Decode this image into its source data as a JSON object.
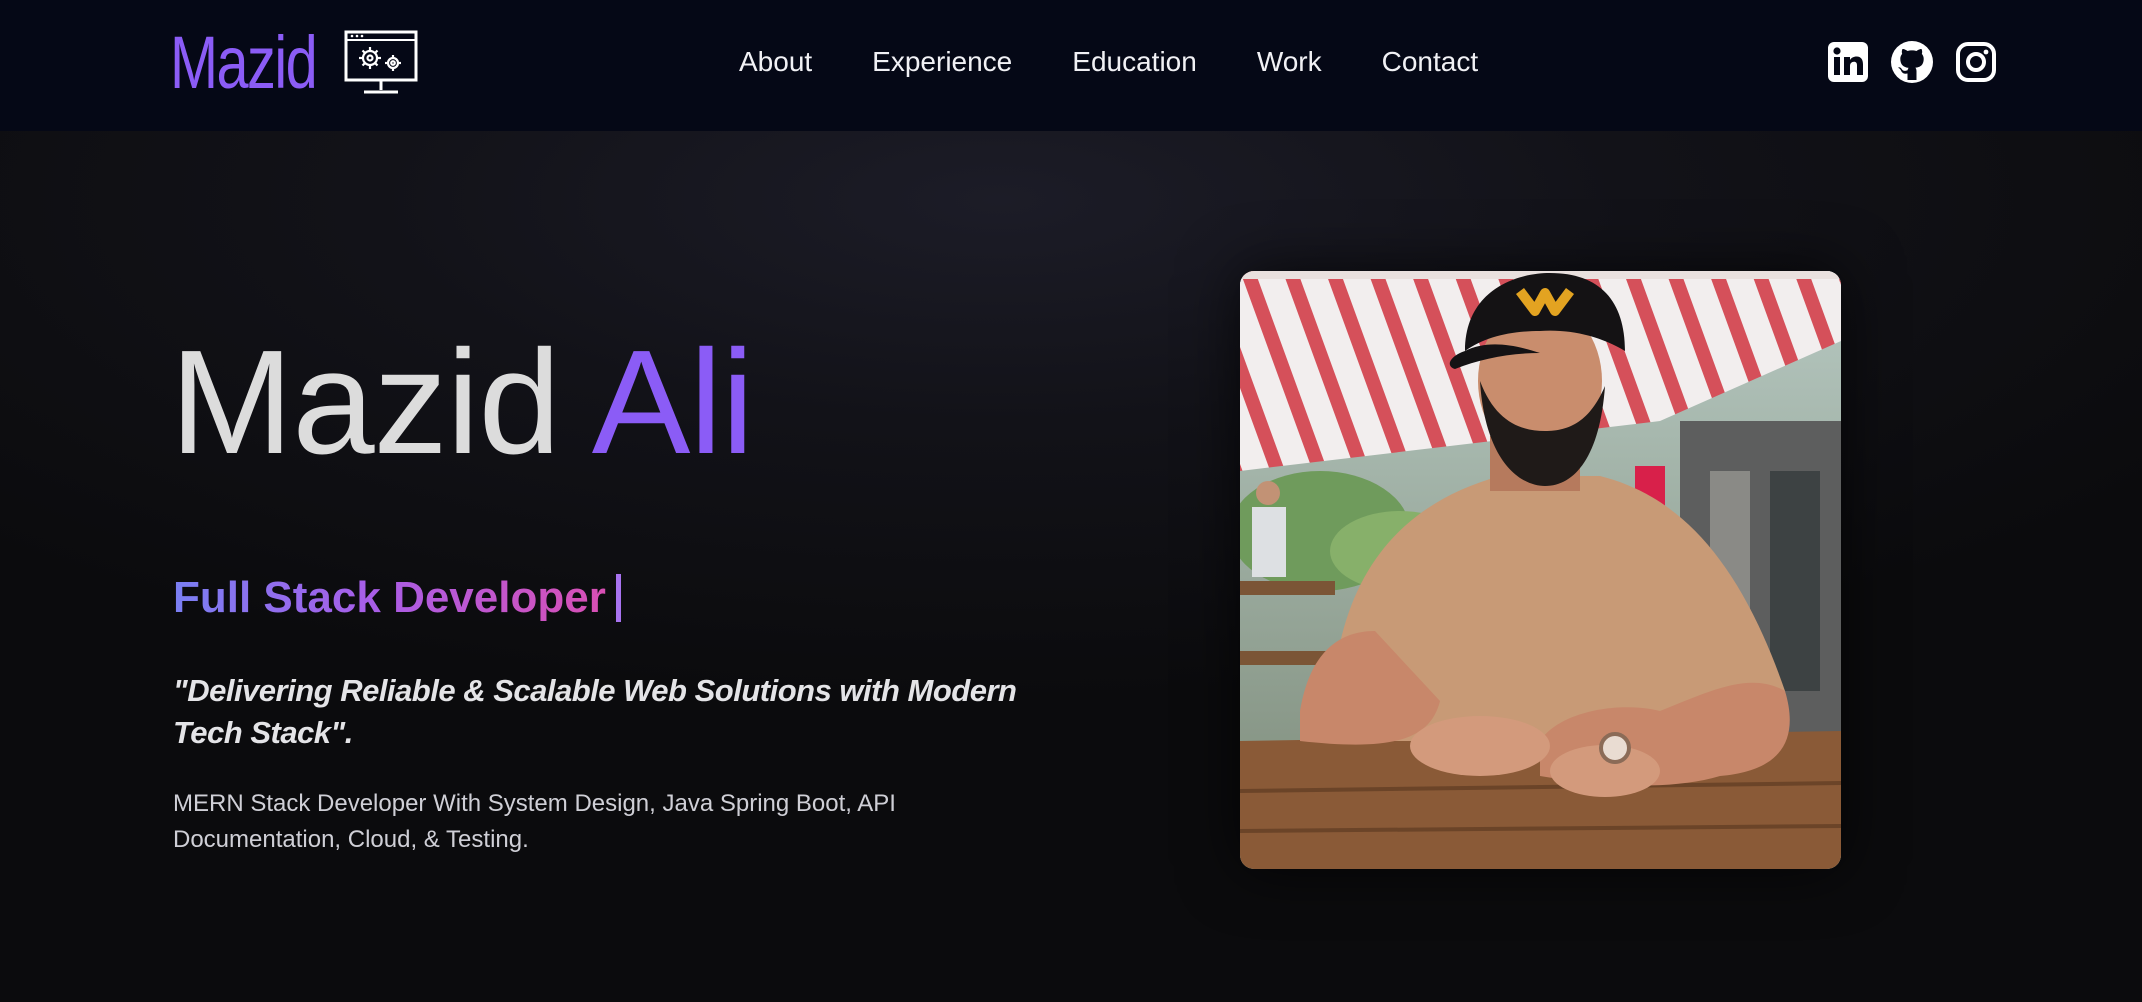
{
  "header": {
    "logo_text": "Mazid",
    "logo_icon": "monitor-gears-icon",
    "nav": [
      {
        "label": "About"
      },
      {
        "label": "Experience"
      },
      {
        "label": "Education"
      },
      {
        "label": "Work"
      },
      {
        "label": "Contact"
      }
    ],
    "social": [
      {
        "icon": "linkedin-icon"
      },
      {
        "icon": "github-icon"
      },
      {
        "icon": "instagram-icon"
      }
    ]
  },
  "hero": {
    "first_name": "Mazid",
    "last_name": "Ali",
    "role": "Full Stack Developer",
    "tagline": "\"Delivering Reliable & Scalable Web Solutions with Modern Tech Stack\".",
    "summary": "MERN Stack Developer With System Design, Java Spring Boot, API Documentation, Cloud, & Testing.",
    "photo_icon": "profile-photo"
  },
  "colors": {
    "accent": "#8b5cf6",
    "nav_background": "#050816",
    "page_background": "#0b0b0d",
    "role_gradient_start": "#7a7ff2",
    "role_gradient_end": "#d94fb4"
  }
}
